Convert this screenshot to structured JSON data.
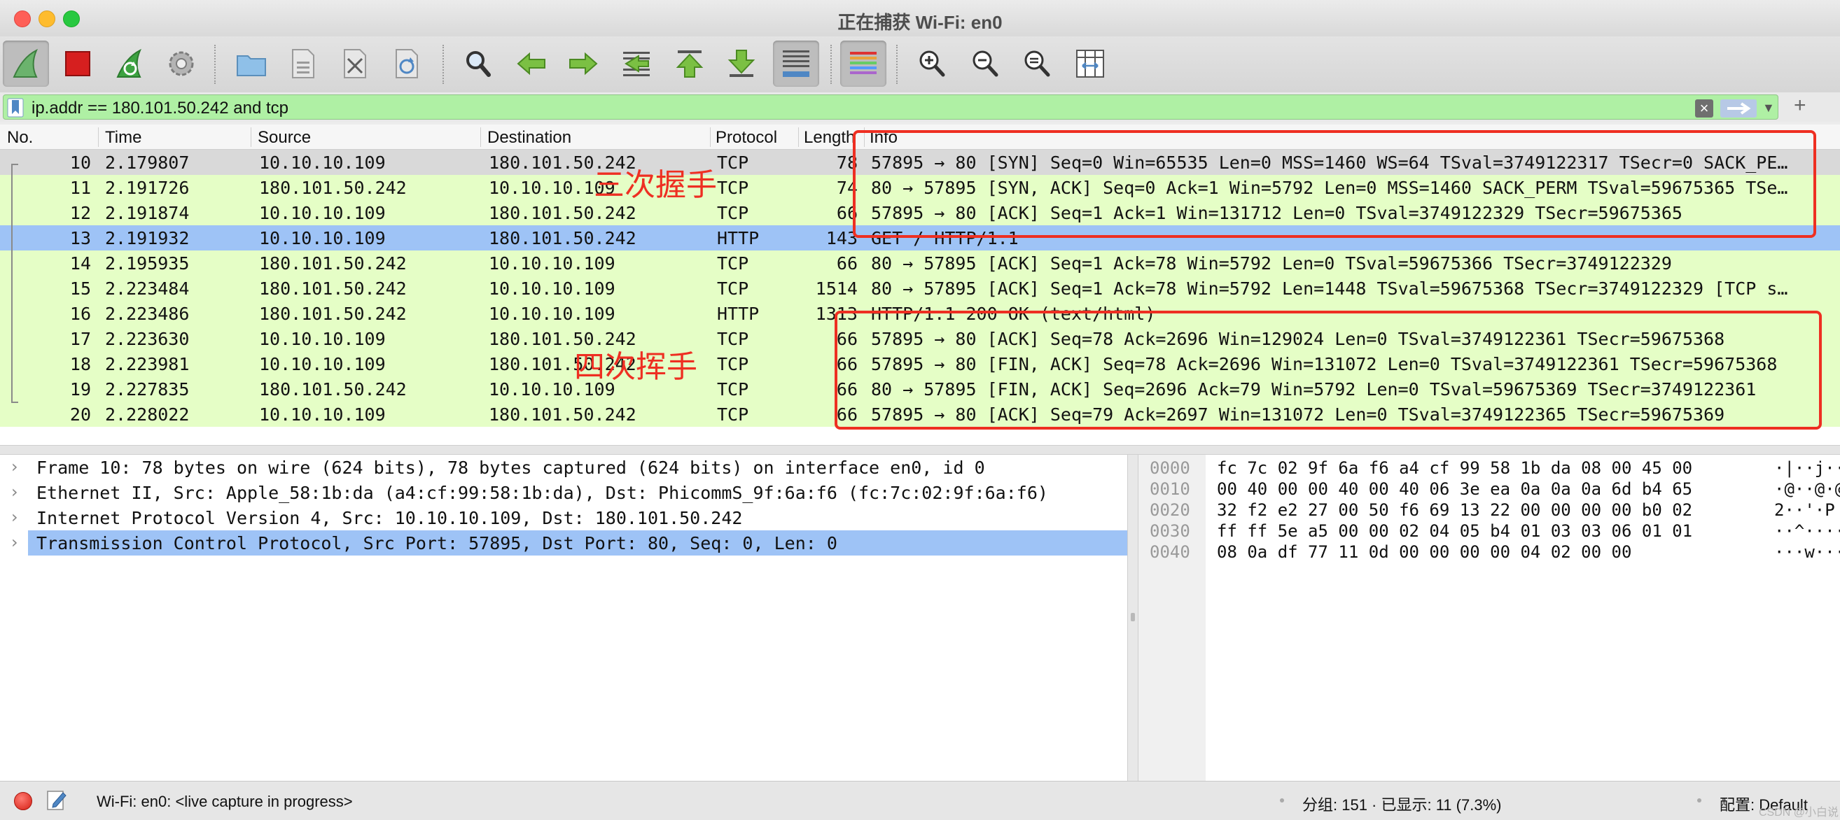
{
  "window": {
    "title": "正在捕获 Wi-Fi: en0"
  },
  "toolbar": {
    "buttons": [
      {
        "name": "start-capture-icon",
        "active": true
      },
      {
        "name": "stop-capture-icon"
      },
      {
        "name": "restart-capture-icon"
      },
      {
        "name": "capture-options-icon"
      },
      {
        "name": "open-file-icon"
      },
      {
        "name": "save-file-icon"
      },
      {
        "name": "close-file-icon"
      },
      {
        "name": "reload-file-icon"
      },
      {
        "name": "find-packet-icon"
      },
      {
        "name": "go-back-icon"
      },
      {
        "name": "go-forward-icon"
      },
      {
        "name": "go-to-packet-icon"
      },
      {
        "name": "first-packet-icon"
      },
      {
        "name": "last-packet-icon"
      },
      {
        "name": "autoscroll-icon",
        "active": true
      },
      {
        "name": "colorize-icon",
        "active": true
      },
      {
        "name": "zoom-in-icon"
      },
      {
        "name": "zoom-out-icon"
      },
      {
        "name": "normal-size-icon"
      },
      {
        "name": "resize-columns-icon"
      }
    ]
  },
  "filter": {
    "value": "ip.addr == 180.101.50.242 and tcp",
    "color": "#aff0a4"
  },
  "packet_list": {
    "columns": [
      "No.",
      "Time",
      "Source",
      "Destination",
      "Protocol",
      "Length",
      "Info"
    ],
    "rows": [
      {
        "no": "10",
        "time": "2.179807",
        "src": "10.10.10.109",
        "dst": "180.101.50.242",
        "proto": "TCP",
        "len": "78",
        "info": "57895 → 80 [SYN] Seq=0 Win=65535 Len=0 MSS=1460 WS=64 TSval=3749122317 TSecr=0 SACK_PE…",
        "color": "#d9d9d9"
      },
      {
        "no": "11",
        "time": "2.191726",
        "src": "180.101.50.242",
        "dst": "10.10.10.109",
        "proto": "TCP",
        "len": "74",
        "info": "80 → 57895 [SYN, ACK] Seq=0 Ack=1 Win=5792 Len=0 MSS=1460 SACK_PERM TSval=59675365 TSe…",
        "color": "#e5fec6"
      },
      {
        "no": "12",
        "time": "2.191874",
        "src": "10.10.10.109",
        "dst": "180.101.50.242",
        "proto": "TCP",
        "len": "66",
        "info": "57895 → 80 [ACK] Seq=1 Ack=1 Win=131712 Len=0 TSval=3749122329 TSecr=59675365",
        "color": "#e5fec6"
      },
      {
        "no": "13",
        "time": "2.191932",
        "src": "10.10.10.109",
        "dst": "180.101.50.242",
        "proto": "HTTP",
        "len": "143",
        "info": "GET / HTTP/1.1",
        "color": "#9ec3f6"
      },
      {
        "no": "14",
        "time": "2.195935",
        "src": "180.101.50.242",
        "dst": "10.10.10.109",
        "proto": "TCP",
        "len": "66",
        "info": "80 → 57895 [ACK] Seq=1 Ack=78 Win=5792 Len=0 TSval=59675366 TSecr=3749122329",
        "color": "#e5fec6"
      },
      {
        "no": "15",
        "time": "2.223484",
        "src": "180.101.50.242",
        "dst": "10.10.10.109",
        "proto": "TCP",
        "len": "1514",
        "info": "80 → 57895 [ACK] Seq=1 Ack=78 Win=5792 Len=1448 TSval=59675368 TSecr=3749122329 [TCP s…",
        "color": "#e5fec6"
      },
      {
        "no": "16",
        "time": "2.223486",
        "src": "180.101.50.242",
        "dst": "10.10.10.109",
        "proto": "HTTP",
        "len": "1313",
        "info": "HTTP/1.1 200 OK  (text/html)",
        "color": "#e5fec6"
      },
      {
        "no": "17",
        "time": "2.223630",
        "src": "10.10.10.109",
        "dst": "180.101.50.242",
        "proto": "TCP",
        "len": "66",
        "info": "57895 → 80 [ACK] Seq=78 Ack=2696 Win=129024 Len=0 TSval=3749122361 TSecr=59675368",
        "color": "#e5fec6"
      },
      {
        "no": "18",
        "time": "2.223981",
        "src": "10.10.10.109",
        "dst": "180.101.50.242",
        "proto": "TCP",
        "len": "66",
        "info": "57895 → 80 [FIN, ACK] Seq=78 Ack=2696 Win=131072 Len=0 TSval=3749122361 TSecr=59675368",
        "color": "#e5fec6"
      },
      {
        "no": "19",
        "time": "2.227835",
        "src": "180.101.50.242",
        "dst": "10.10.10.109",
        "proto": "TCP",
        "len": "66",
        "info": "80 → 57895 [FIN, ACK] Seq=2696 Ack=79 Win=5792 Len=0 TSval=59675369 TSecr=3749122361",
        "color": "#e5fec6"
      },
      {
        "no": "20",
        "time": "2.228022",
        "src": "10.10.10.109",
        "dst": "180.101.50.242",
        "proto": "TCP",
        "len": "66",
        "info": "57895 → 80 [ACK] Seq=79 Ack=2697 Win=131072 Len=0 TSval=3749122365 TSecr=59675369",
        "color": "#e5fec6"
      }
    ]
  },
  "annotations": {
    "handshake_label": "三次握手",
    "teardown_label": "四次挥手",
    "color": "#ee2f22"
  },
  "details": {
    "rows": [
      {
        "text": "Frame 10: 78 bytes on wire (624 bits), 78 bytes captured (624 bits) on interface en0, id 0",
        "selected": false
      },
      {
        "text": "Ethernet II, Src: Apple_58:1b:da (a4:cf:99:58:1b:da), Dst: PhicommS_9f:6a:f6 (fc:7c:02:9f:6a:f6)",
        "selected": false
      },
      {
        "text": "Internet Protocol Version 4, Src: 10.10.10.109, Dst: 180.101.50.242",
        "selected": false
      },
      {
        "text": "Transmission Control Protocol, Src Port: 57895, Dst Port: 80, Seq: 0, Len: 0",
        "selected": true
      }
    ]
  },
  "hex": {
    "rows": [
      {
        "off": "0000",
        "bytes": "fc 7c 02 9f 6a f6 a4 cf  99 58 1b da 08 00 45 00",
        "ascii": "·|··j···"
      },
      {
        "off": "0010",
        "bytes": "00 40 00 00 40 00 40 06  3e ea 0a 0a 0a 6d b4 65",
        "ascii": "·@··@·@·"
      },
      {
        "off": "0020",
        "bytes": "32 f2 e2 27 00 50 f6 69  13 22 00 00 00 00 b0 02",
        "ascii": "2··'·P"
      },
      {
        "off": "0030",
        "bytes": "ff ff 5e a5 00 00 02 04  05 b4 01 03 03 06 01 01",
        "ascii": "··^·····"
      },
      {
        "off": "0040",
        "bytes": "08 0a df 77 11 0d 00 00  00 00 04 02 00 00",
        "ascii": "···w····"
      }
    ]
  },
  "status": {
    "interface": "Wi-Fi: en0: <live capture in progress>",
    "packets": "分组: 151 · 已显示: 11 (7.3%)",
    "profile": "配置: Default",
    "watermark": "CSDN @小白说编程"
  }
}
